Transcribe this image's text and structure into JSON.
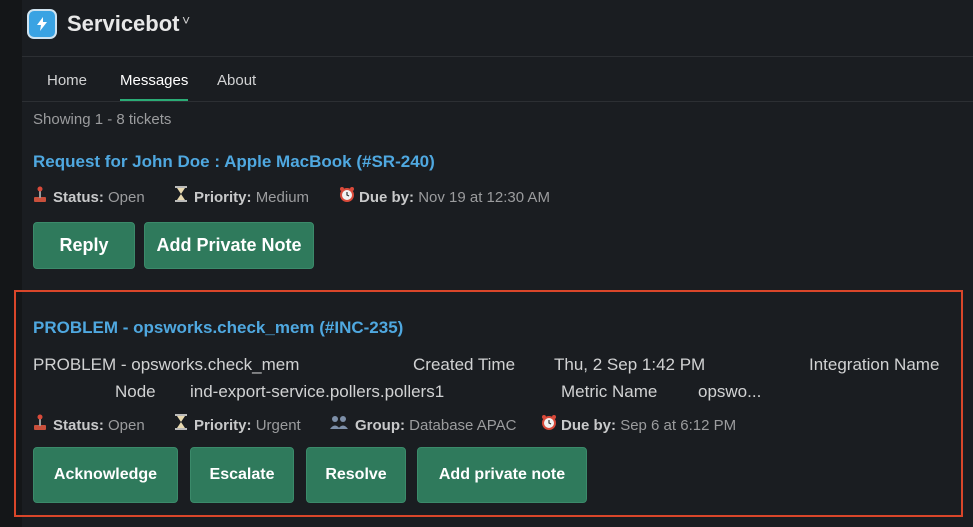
{
  "header": {
    "app_name": "Servicebot",
    "caret": "˅"
  },
  "tabs": [
    {
      "label": "Home"
    },
    {
      "label": "Messages"
    },
    {
      "label": "About"
    }
  ],
  "showing_text": "Showing 1 - 8 tickets",
  "ticket1": {
    "title": "Request for John Doe : Apple MacBook (#SR-240)",
    "status_label": "Status:",
    "status_value": "Open",
    "priority_label": "Priority:",
    "priority_value": "Medium",
    "due_label": "Due by:",
    "due_value": "Nov 19 at 12:30 AM",
    "buttons": {
      "reply": "Reply",
      "add_note": "Add Private Note"
    }
  },
  "ticket2": {
    "title": "PROBLEM - opsworks.check_mem (#INC-235)",
    "detail1": {
      "problem": "PROBLEM - opsworks.check_mem",
      "created_label": "Created Time",
      "created_value": "Thu, 2 Sep  1:42 PM",
      "integration_label": "Integration Name"
    },
    "detail2": {
      "node_label": "Node",
      "node_value": "ind-export-service.pollers.pollers1",
      "metric_label": "Metric Name",
      "metric_value": "opswo..."
    },
    "status_label": "Status:",
    "status_value": "Open",
    "priority_label": "Priority:",
    "priority_value": "Urgent",
    "group_label": "Group:",
    "group_value": "Database APAC",
    "due_label": "Due by:",
    "due_value": "Sep 6 at 6:12 PM",
    "buttons": {
      "acknowledge": "Acknowledge",
      "escalate": "Escalate",
      "resolve": "Resolve",
      "add_note": "Add private note"
    }
  },
  "colors": {
    "accent": "#2bac76",
    "link": "#4fa8e0",
    "button": "#2f7a5c",
    "highlight": "#d9462a"
  }
}
